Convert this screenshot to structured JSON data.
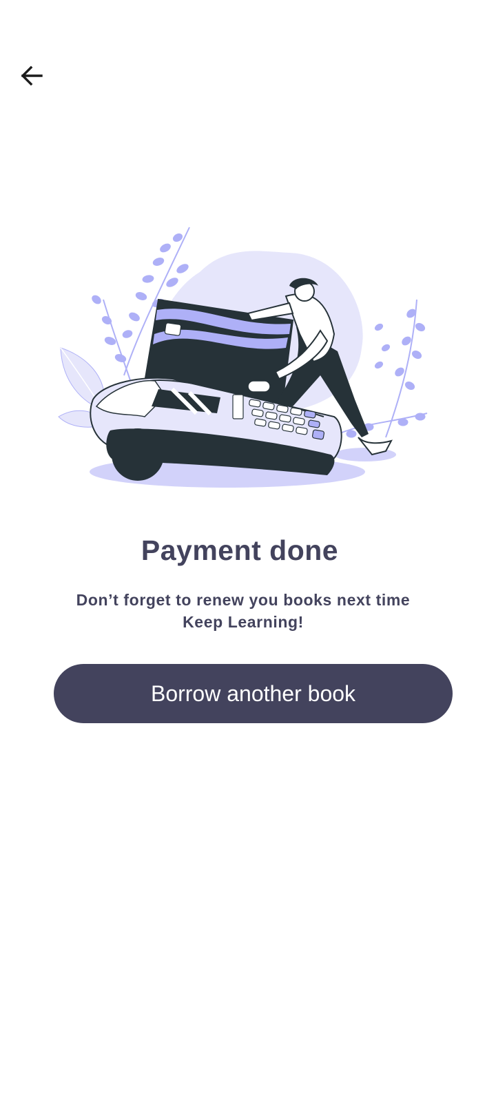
{
  "header": {
    "back_icon": "arrow-left-icon"
  },
  "illustration": {
    "name": "payment-terminal-illustration",
    "colors": {
      "accent": "#aeb0f7",
      "accent_light": "#e6e6fb",
      "dark": "#263238"
    }
  },
  "content": {
    "title": "Payment done",
    "message_line1": "Don’t forget to renew you books next time",
    "message_line2": "Keep Learning!",
    "button_label": "Borrow another book"
  },
  "colors": {
    "primary": "#43435d",
    "background": "#ffffff"
  }
}
